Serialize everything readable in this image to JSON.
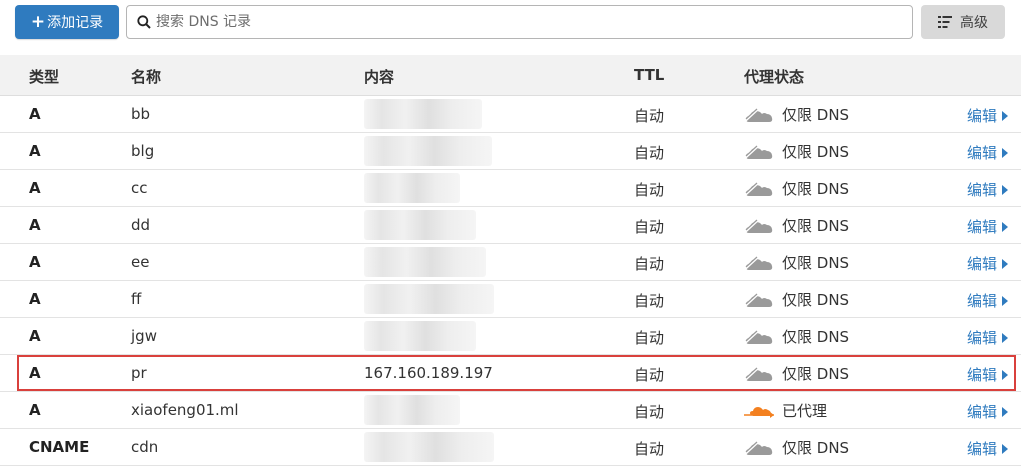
{
  "toolbar": {
    "add_label": "添加记录",
    "add_plus": "+",
    "search_placeholder": "搜索 DNS 记录",
    "advanced_label": "高级"
  },
  "table": {
    "headers": [
      "类型",
      "名称",
      "内容",
      "TTL",
      "代理状态"
    ],
    "edit_label": "编辑",
    "rows": [
      {
        "type": "A",
        "name": "bb",
        "content": "",
        "ttl": "自动",
        "proxy": "仅限 DNS"
      },
      {
        "type": "A",
        "name": "blg",
        "content": "",
        "ttl": "自动",
        "proxy": "仅限 DNS"
      },
      {
        "type": "A",
        "name": "cc",
        "content": "",
        "ttl": "自动",
        "proxy": "仅限 DNS"
      },
      {
        "type": "A",
        "name": "dd",
        "content": "",
        "ttl": "自动",
        "proxy": "仅限 DNS"
      },
      {
        "type": "A",
        "name": "ee",
        "content": "",
        "ttl": "自动",
        "proxy": "仅限 DNS"
      },
      {
        "type": "A",
        "name": "ff",
        "content": "",
        "ttl": "自动",
        "proxy": "仅限 DNS"
      },
      {
        "type": "A",
        "name": "jgw",
        "content": "",
        "ttl": "自动",
        "proxy": "仅限 DNS"
      },
      {
        "type": "A",
        "name": "pr",
        "content": "167.160.189.197",
        "ttl": "自动",
        "proxy": "仅限 DNS"
      },
      {
        "type": "A",
        "name": "xiaofeng01.ml",
        "content": "",
        "ttl": "自动",
        "proxy": "已代理"
      },
      {
        "type": "CNAME",
        "name": "cdn",
        "content": "",
        "ttl": "自动",
        "proxy": "仅限 DNS"
      }
    ]
  },
  "colors": {
    "accent": "#2f7bbf",
    "highlight": "#d9403c",
    "proxied": "#f38020",
    "dns_only": "#9a9a9a"
  }
}
